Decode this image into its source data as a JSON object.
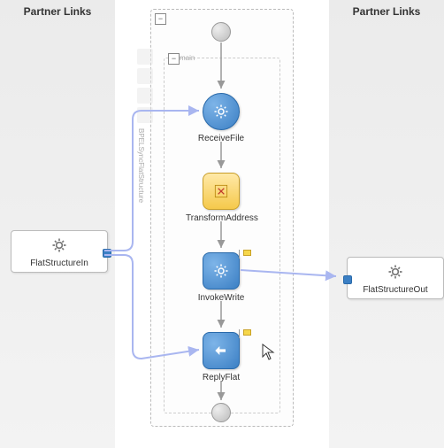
{
  "headers": {
    "left": "Partner Links",
    "right": "Partner Links"
  },
  "partnerLinks": {
    "left": {
      "label": "FlatStructureIn"
    },
    "right": {
      "label": "FlatStructureOut"
    }
  },
  "activities": {
    "receive": "ReceiveFile",
    "transform": "TransformAddress",
    "invoke": "InvokeWrite",
    "reply": "ReplyFlat"
  },
  "sidebar": {
    "tag": "main",
    "processLabel": "BPELSyncFlatStructure"
  },
  "colors": {
    "blue": "#3b7fc4",
    "yellow": "#f5c94b",
    "link": "#a9b6f0"
  }
}
